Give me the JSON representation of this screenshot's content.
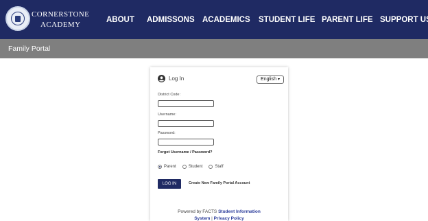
{
  "header": {
    "brand_line1": "Cornerstone",
    "brand_line2": "Academy",
    "nav": [
      "ABOUT",
      "ADMISSONS",
      "ACADEMICS",
      "STUDENT LIFE",
      "PARENT LIFE",
      "SUPPORT US"
    ]
  },
  "subbar": {
    "title": "Family Portal"
  },
  "login": {
    "title": "Log In",
    "language": "English",
    "language_caret": "▾",
    "fields": {
      "district_label": "District Code:",
      "district_value": "",
      "username_label": "Username:",
      "username_value": "",
      "password_label": "Password:",
      "password_value": ""
    },
    "forgot": "Forgot Username / Password?",
    "roles": [
      "Parent",
      "Student",
      "Staff"
    ],
    "selected_role": "Parent",
    "login_button": "LOG IN",
    "create_account": "Create New Family Portal Account",
    "footer": {
      "powered_prefix": "Powered by FACTS",
      "sis_link": "Student Information",
      "system_link": "System",
      "separator": "|",
      "privacy_link": "Privacy Policy"
    }
  },
  "colors": {
    "header_bg": "#1f2a63",
    "subbar_bg": "#7f7f7f",
    "link": "#2a3b9a",
    "button_bg": "#1f2a63"
  },
  "icons": {
    "user": "user-circle-icon",
    "logo": "school-seal-logo"
  }
}
